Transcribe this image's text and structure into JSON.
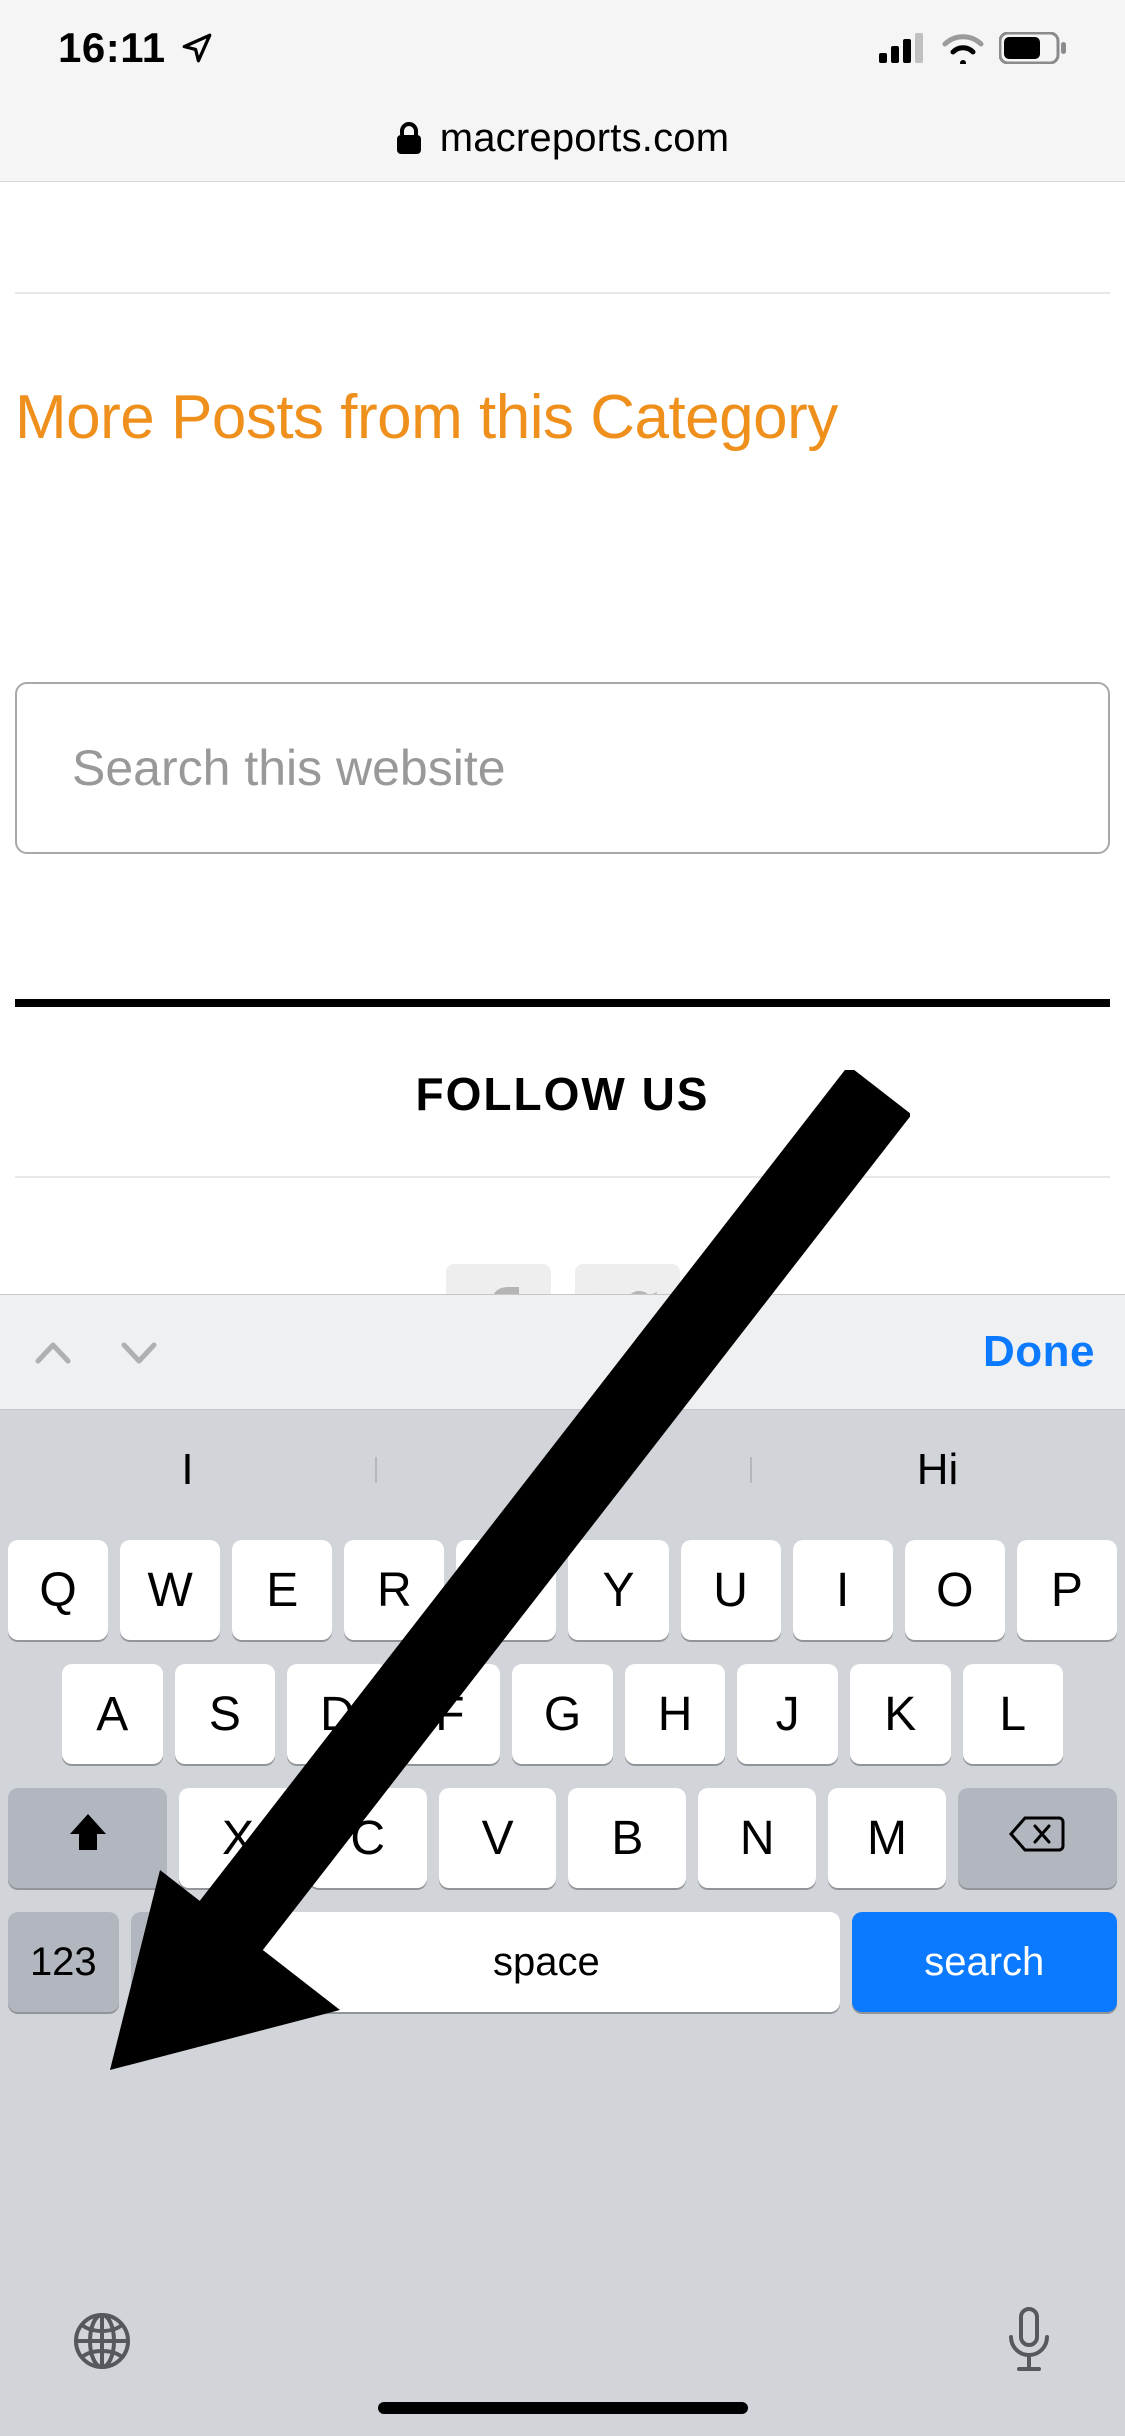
{
  "statusbar": {
    "time": "16:11"
  },
  "url": "macreports.com",
  "page": {
    "heading": "More Posts from this Category",
    "search_placeholder": "Search this website",
    "follow_label": "FOLLOW US"
  },
  "accessory": {
    "done": "Done"
  },
  "suggestions": [
    "I",
    "ey",
    "Hi"
  ],
  "keys_row1": [
    "Q",
    "W",
    "E",
    "R",
    "T",
    "Y",
    "U",
    "I",
    "O",
    "P"
  ],
  "keys_row2": [
    "A",
    "S",
    "D",
    "F",
    "G",
    "H",
    "J",
    "K",
    "L"
  ],
  "keys_row3": [
    "X",
    "C",
    "V",
    "B",
    "N",
    "M"
  ],
  "numeric_label": "123",
  "space_label": "space",
  "action_label": "search"
}
